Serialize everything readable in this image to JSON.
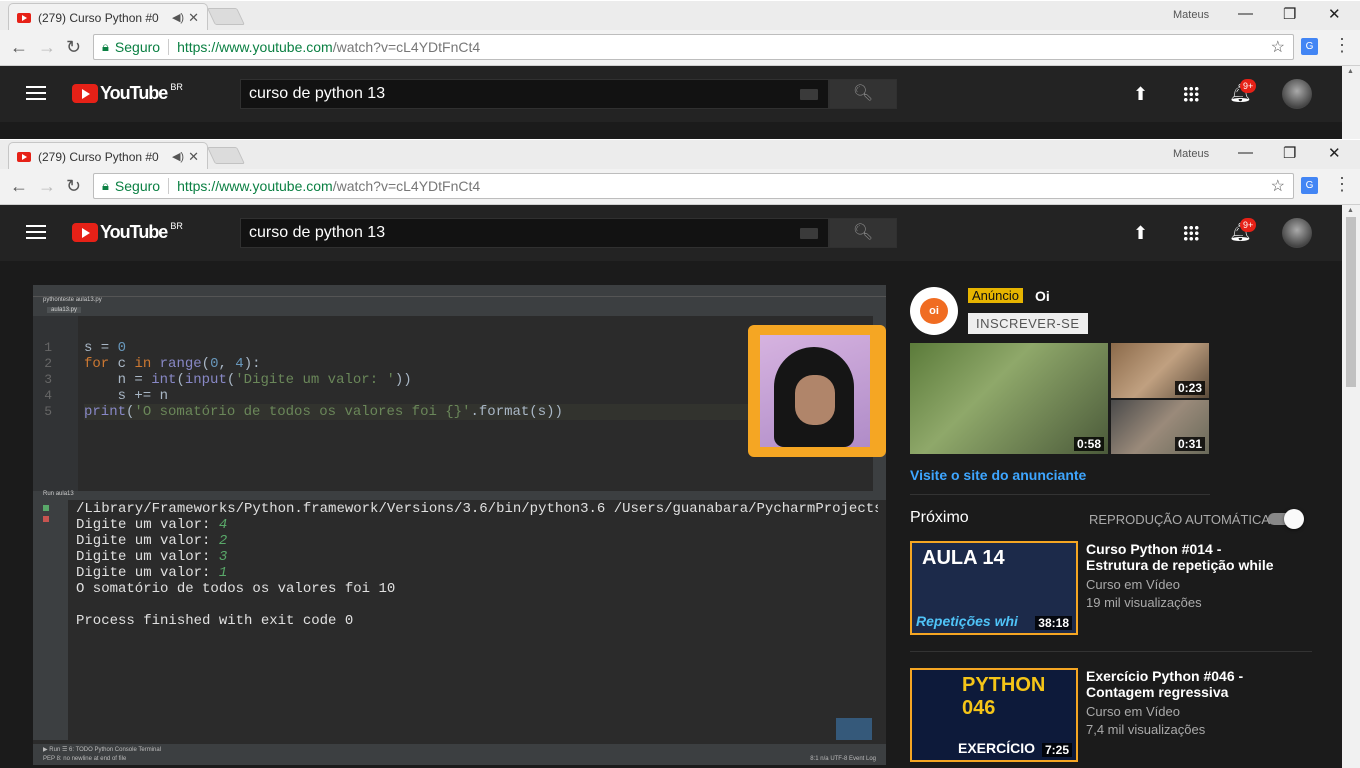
{
  "browser": {
    "tab_title": "(279) Curso Python #0",
    "user": "Mateus",
    "secure": "Seguro",
    "url_base": "https://www.youtube.com",
    "url_path": "/watch?v=cL4YDtFnCt4"
  },
  "yt": {
    "logo": "YouTube",
    "region": "BR",
    "search_value": "curso de python 13",
    "badge": "9+"
  },
  "ide": {
    "run_tab": "aula13",
    "file_tab": "aula13.py",
    "crumbs": "pythonteste  aula13.py",
    "line_numbers": [
      "1",
      "2",
      "3",
      "4",
      "5"
    ],
    "bottom_tabs": "▶ Run   ☰ 6: TODO   Python Console   Terminal",
    "status": "PEP 8: no newline at end of file",
    "status_right": "8:1  n/a  UTF-8  Event Log",
    "console_cmd": "/Library/Frameworks/Python.framework/Versions/3.6/bin/python3.6 /Users/guanabara/PycharmProjects/pyt",
    "prompts": [
      {
        "label": "Digite um valor: ",
        "value": "4"
      },
      {
        "label": "Digite um valor: ",
        "value": "2"
      },
      {
        "label": "Digite um valor: ",
        "value": "3"
      },
      {
        "label": "Digite um valor: ",
        "value": "1"
      }
    ],
    "result": "O somatório de todos os valores foi 10",
    "exit": "Process finished with exit code 0"
  },
  "ad": {
    "badge": "Anúncio",
    "name": "Oi",
    "subscribe": "INSCREVER-SE",
    "durations": [
      "0:58",
      "0:23",
      "0:31"
    ],
    "visit": "Visite o site do anunciante"
  },
  "up_next": {
    "label": "Próximo",
    "autoplay": "REPRODUÇÃO AUTOMÁTICA"
  },
  "videos": [
    {
      "title": "Curso Python #014 - Estrutura de repetição while",
      "channel": "Curso em Vídeo",
      "views": "19 mil visualizações",
      "duration": "38:18",
      "thumb_big": "AULA 14",
      "thumb_sub": "Repetições whi"
    },
    {
      "title": "Exercício Python #046 - Contagem regressiva",
      "channel": "Curso em Vídeo",
      "views": "7,4 mil visualizações",
      "duration": "7:25",
      "thumb_big": "PYTHON 046",
      "thumb_sub": "EXERCÍCIO"
    }
  ],
  "colors": {
    "yt_red": "#e62117",
    "accent_orange": "#f5a623",
    "link_blue": "#3ea6ff"
  }
}
